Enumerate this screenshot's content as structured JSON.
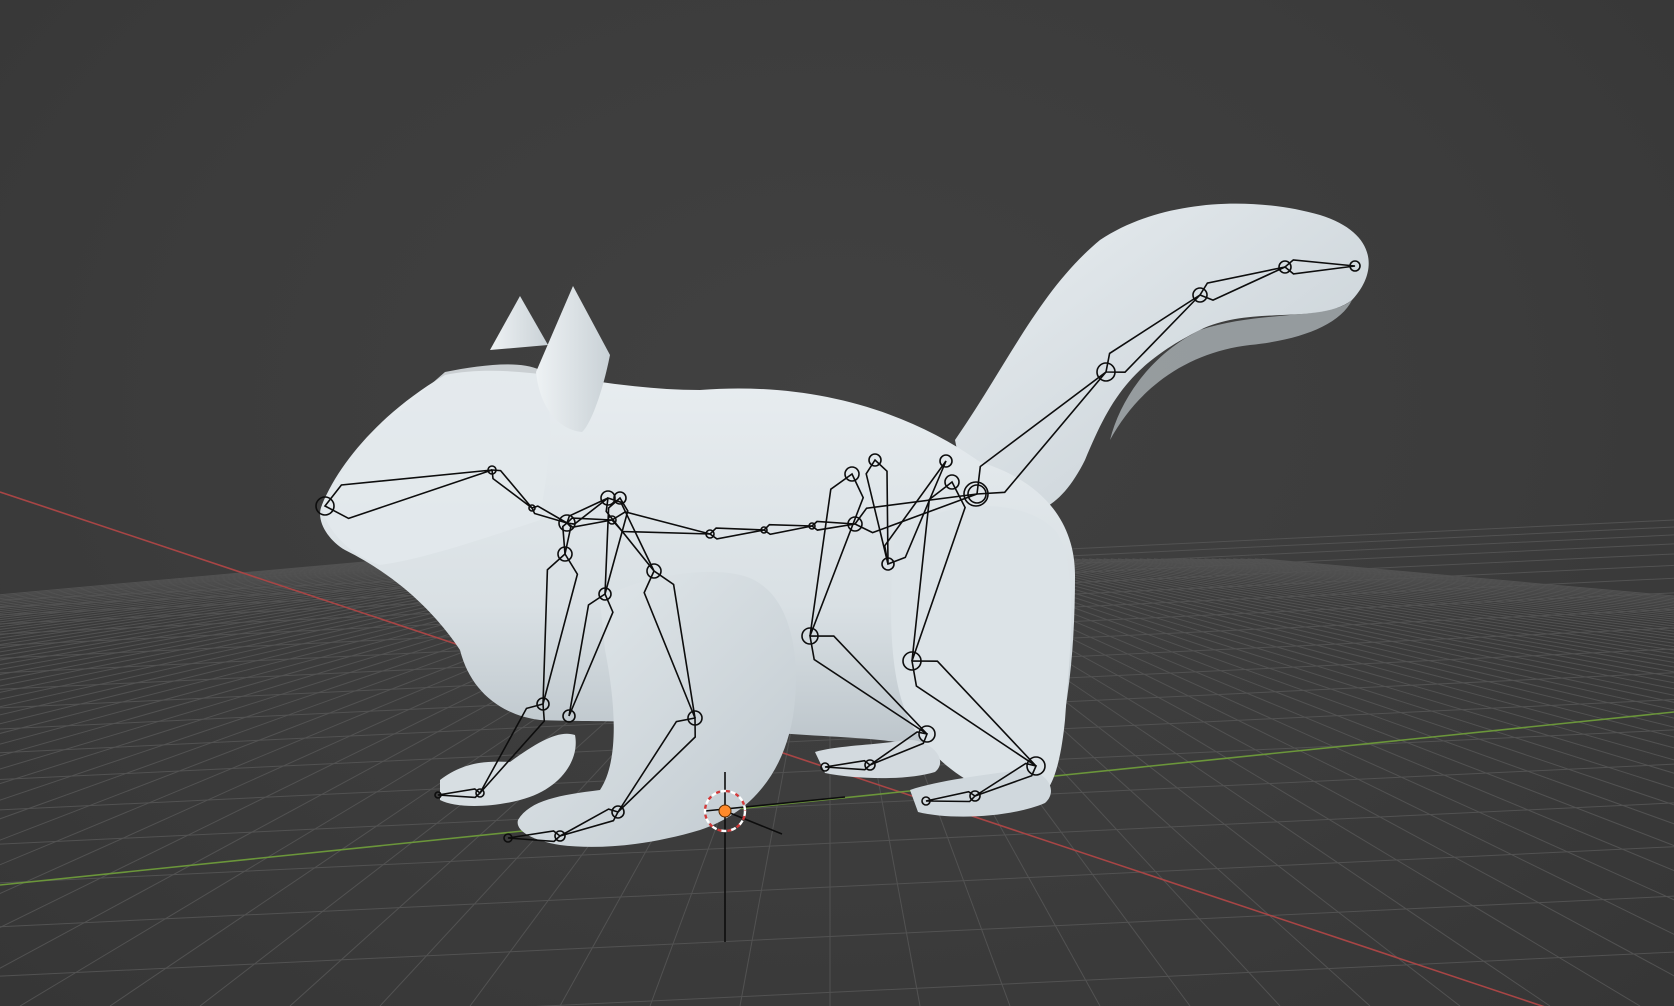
{
  "viewport": {
    "background_color": "#3d3d3d",
    "grid_color": "#525252",
    "x_axis_color": "#b04848",
    "y_axis_color": "#6f9a3c",
    "mesh_color": "#dfe6ea",
    "mesh_shadow_color": "#b6bfc5",
    "bone_color": "#0d0d0d",
    "cursor_accent_color": "#ff8a2a",
    "cursor_ring_colors": [
      "#ffffff",
      "#d23a3a"
    ]
  },
  "scene": {
    "object": "squirrel-mesh",
    "armature": "bone-wireframe",
    "shading_mode": "solid"
  }
}
